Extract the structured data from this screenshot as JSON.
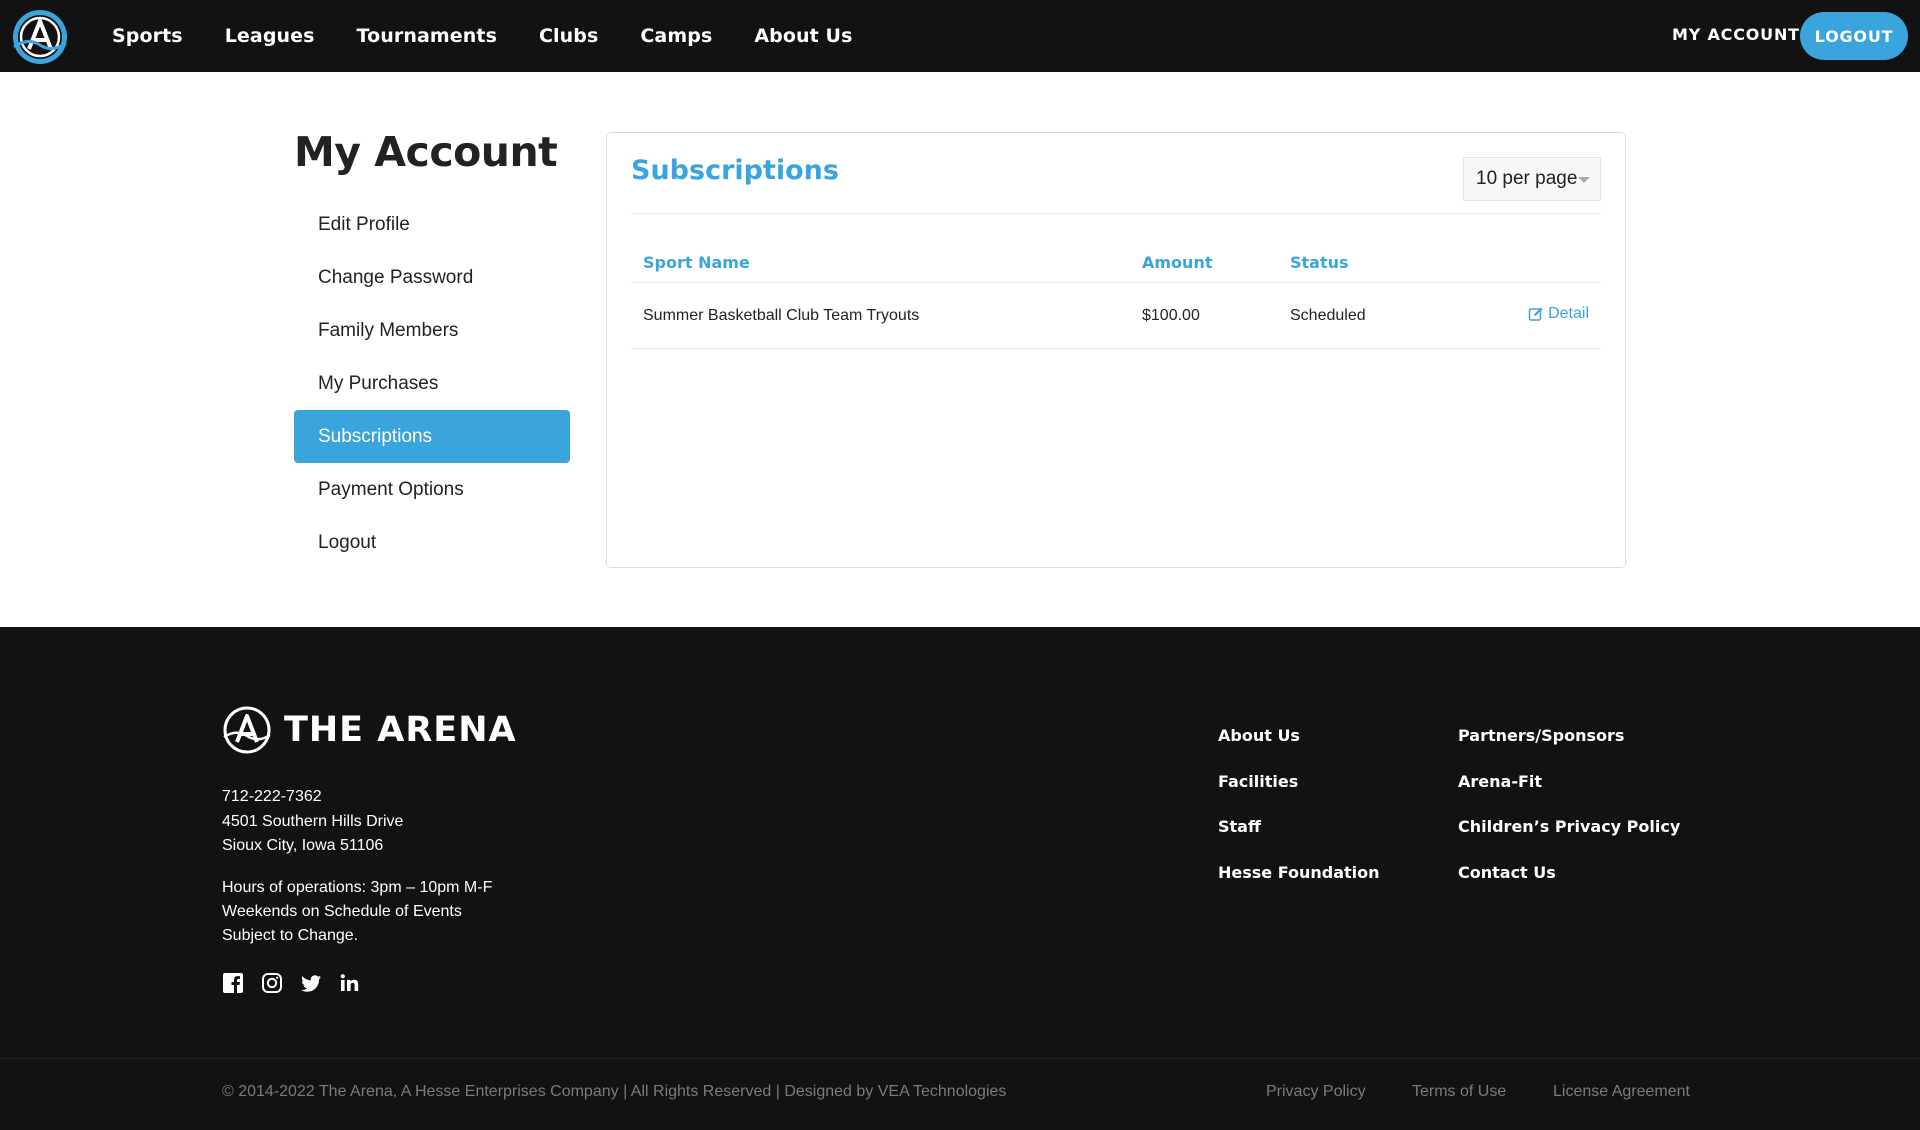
{
  "nav": {
    "items": [
      "Sports",
      "Leagues",
      "Tournaments",
      "Clubs",
      "Camps",
      "About Us"
    ],
    "my_account": "MY ACCOUNT",
    "logout": "LOGOUT"
  },
  "sidebar": {
    "title": "My Account",
    "items": [
      "Edit Profile",
      "Change Password",
      "Family Members",
      "My Purchases",
      "Subscriptions",
      "Payment Options",
      "Logout"
    ],
    "active": "Subscriptions"
  },
  "panel": {
    "title": "Subscriptions",
    "per_page": "10 per page",
    "columns": [
      "Sport Name",
      "Amount",
      "Status"
    ],
    "rows": [
      {
        "sport_name": "Summer Basketball Club Team Tryouts",
        "amount": "$100.00",
        "status": "Scheduled",
        "action": "Detail"
      }
    ]
  },
  "footer": {
    "brand": "THE ARENA",
    "phone": "712-222-7362",
    "address_line1": "4501 Southern Hills Drive",
    "address_line2": "Sioux City, Iowa 51106",
    "hours_line1": "Hours of operations: 3pm – 10pm M-F",
    "hours_line2": "Weekends on Schedule of Events",
    "hours_line3": "Subject to Change.",
    "social_icons": [
      "facebook-icon",
      "instagram-icon",
      "twitter-icon",
      "linkedin-icon"
    ],
    "links_col1": [
      "About Us",
      "Facilities",
      "Staff",
      "Hesse Foundation"
    ],
    "links_col2": [
      "Partners/Sponsors",
      "Arena-Fit",
      "Children’s Privacy Policy",
      "Contact Us"
    ],
    "copyright": "© 2014-2022 The Arena, A Hesse Enterprises Company | All Rights Reserved | Designed by VEA Technologies",
    "legal": [
      "Privacy Policy",
      "Terms of Use",
      "License Agreement"
    ]
  },
  "colors": {
    "accent": "#3aa4dc",
    "nav_bg": "#121212",
    "footer_bg": "#121212"
  }
}
